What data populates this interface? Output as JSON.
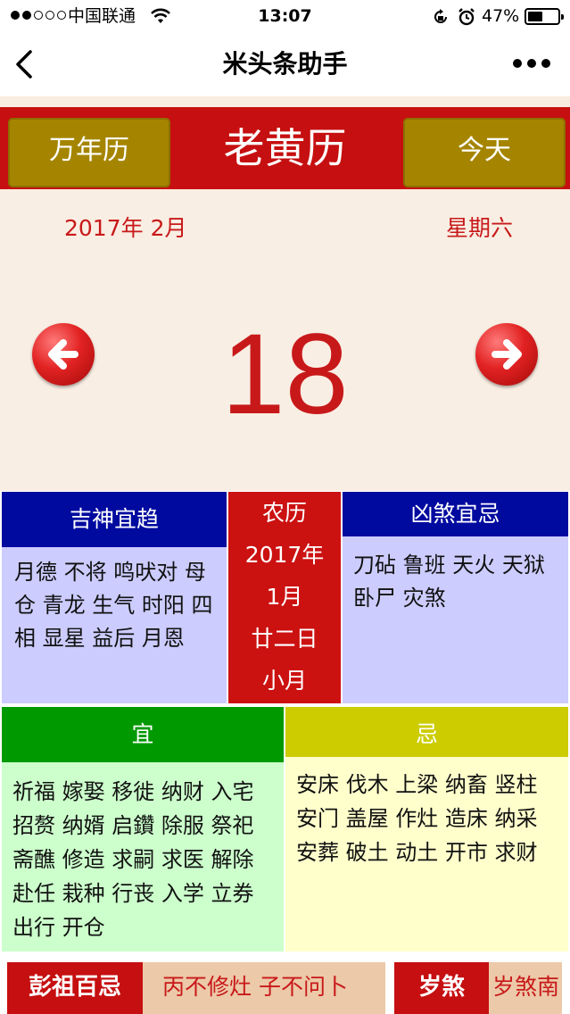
{
  "status_bar": {
    "carrier": "中国联通",
    "time": "13:07",
    "battery_percent": "47%"
  },
  "nav": {
    "title": "米头条助手",
    "back_icon": "chevron-left-icon",
    "more_icon": "more-dots-icon"
  },
  "header": {
    "left_button": "万年历",
    "title": "老黄历",
    "right_button": "今天"
  },
  "date": {
    "year_month": "2017年 2月",
    "weekday": "星期六",
    "day": "18"
  },
  "auspicious_gods": {
    "title": "吉神宜趋",
    "text": "月德 不将 鸣吠对 母仓 青龙 生气 时阳 四相 显星 益后 月恩"
  },
  "lunar": {
    "label": "农历",
    "year": "2017年",
    "month": "1月",
    "day": "廿二日",
    "month_size": "小月"
  },
  "inauspicious_gods": {
    "title": "凶煞宜忌",
    "text": "刀砧 鲁班 天火 天狱 卧尸 灾煞"
  },
  "yi": {
    "title": "宜",
    "text": "祈福 嫁娶 移徙 纳财 入宅 招赘 纳婿 启鑽 除服 祭祀 斋醮 修造 求嗣 求医 解除 赴任 栽种 行丧 入学 立券 出行 开仓"
  },
  "ji": {
    "title": "忌",
    "text": "安床 伐木 上梁 纳畜 竖柱 安门 盖屋 作灶 造床 纳采 安葬 破土 动土 开市 求财"
  },
  "pengzu": {
    "label": "彭祖百忌",
    "value": "丙不修灶 子不问卜"
  },
  "suisha": {
    "label": "岁煞",
    "value": "岁煞南"
  },
  "colors": {
    "header_red": "#c60f10",
    "gold_button": "#a58500",
    "navy": "#000a9f",
    "lavender": "#ccccff",
    "green": "#009900",
    "mint": "#ccffcc",
    "olive": "#cccc00",
    "cream": "#ffffcc"
  }
}
